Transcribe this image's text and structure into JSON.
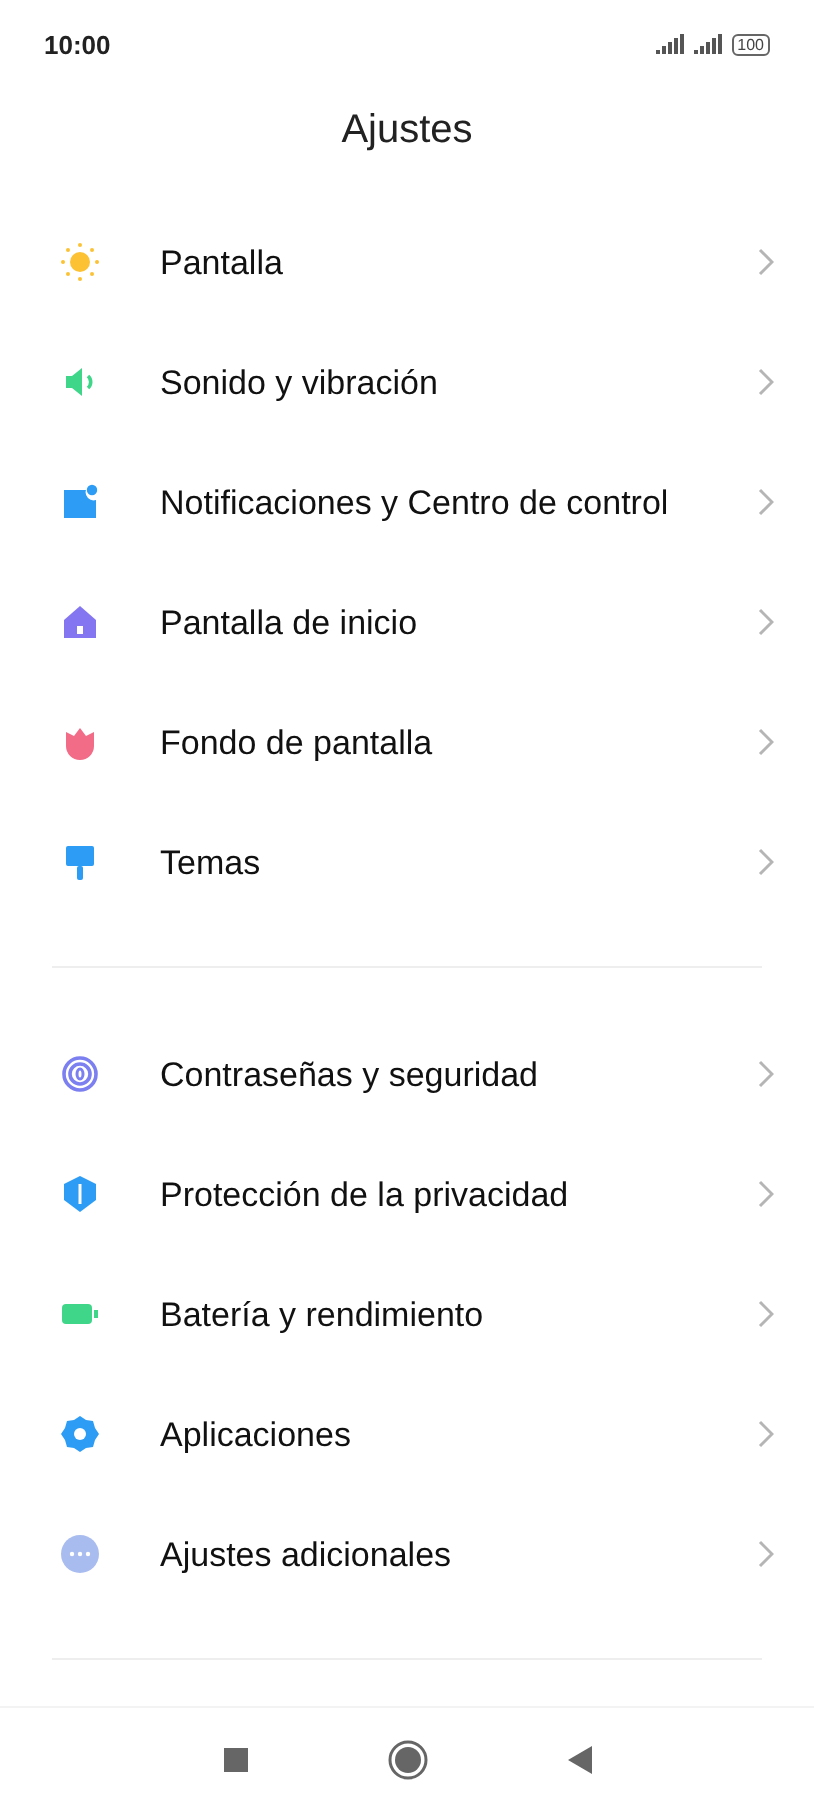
{
  "status_bar": {
    "time": "10:00",
    "battery": "100"
  },
  "title": "Ajustes",
  "sections": [
    {
      "items": [
        {
          "kind": "display",
          "label": "Pantalla"
        },
        {
          "kind": "sound",
          "label": "Sonido y vibración"
        },
        {
          "kind": "notifications",
          "label": "Notificaciones y Centro de control"
        },
        {
          "kind": "home",
          "label": "Pantalla de inicio"
        },
        {
          "kind": "wallpaper",
          "label": "Fondo de pantalla"
        },
        {
          "kind": "themes",
          "label": "Temas"
        }
      ]
    },
    {
      "items": [
        {
          "kind": "passwords",
          "label": "Contraseñas y seguridad"
        },
        {
          "kind": "privacy",
          "label": "Protección de la privacidad"
        },
        {
          "kind": "battery",
          "label": "Batería y rendimiento"
        },
        {
          "kind": "apps",
          "label": "Aplicaciones"
        },
        {
          "kind": "more",
          "label": "Ajustes adicionales"
        }
      ]
    }
  ]
}
